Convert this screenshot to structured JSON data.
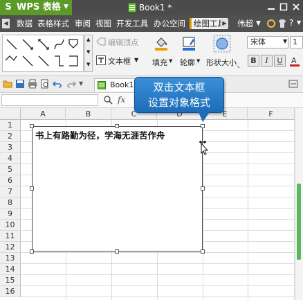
{
  "titlebar": {
    "app_name": "WPS 表格",
    "logo_glyph": "S",
    "doc_title": "Book1 *"
  },
  "menu": {
    "items": [
      "数据",
      "表格样式",
      "审阅",
      "视图",
      "开发工具",
      "办公空间",
      "绘图工具"
    ],
    "active": "绘图工具",
    "right_label": "伟超"
  },
  "ribbon": {
    "edit_vertex_label": "编辑顶点",
    "textbox_label": "文本框",
    "fill_label": "填充",
    "outline_label": "轮廓",
    "shape_size_label": "形状大小",
    "font_name": "宋体",
    "font_size": "1",
    "bold": "B",
    "italic": "I",
    "underline": "U"
  },
  "qat": {
    "tab_label": "Book1"
  },
  "formula_bar": {
    "fx_label": "fx"
  },
  "grid": {
    "columns": [
      "A",
      "B",
      "C",
      "D",
      "E",
      "F"
    ],
    "rows": [
      "1",
      "2",
      "3",
      "4",
      "5",
      "6",
      "7",
      "8",
      "9",
      "10",
      "11",
      "12",
      "13",
      "14",
      "15",
      "16"
    ]
  },
  "textbox": {
    "text": "书上有路勤为径，学海无涯苦作舟"
  },
  "tooltip": {
    "line1": "双击文本框",
    "line2": "设置对象格式"
  },
  "colors": {
    "title_bg": "#4b4b4b",
    "wps_green": "#5b9a28",
    "tooltip_blue": "#1e6cb8",
    "active_tab_accent": "#e8a000"
  }
}
